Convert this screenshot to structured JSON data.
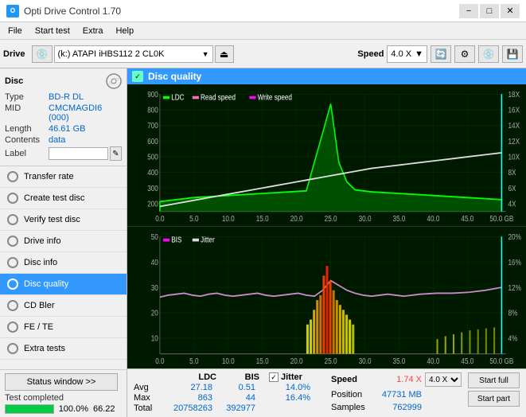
{
  "titlebar": {
    "title": "Opti Drive Control 1.70",
    "icon": "O",
    "min": "−",
    "max": "□",
    "close": "✕"
  },
  "menubar": {
    "items": [
      "File",
      "Start test",
      "Extra",
      "Help"
    ]
  },
  "toolbar": {
    "drive_label": "Drive",
    "drive_value": "(k:) ATAPI iHBS112  2 CL0K",
    "speed_label": "Speed",
    "speed_value": "4.0 X"
  },
  "sidebar": {
    "disc_title": "Disc",
    "disc_type_label": "Type",
    "disc_type_value": "BD-R DL",
    "disc_mid_label": "MID",
    "disc_mid_value": "CMCMAGDI6 (000)",
    "disc_length_label": "Length",
    "disc_length_value": "46.61 GB",
    "disc_contents_label": "Contents",
    "disc_contents_value": "data",
    "disc_label_label": "Label",
    "disc_label_value": "",
    "nav_items": [
      {
        "id": "transfer-rate",
        "label": "Transfer rate",
        "active": false
      },
      {
        "id": "create-test-disc",
        "label": "Create test disc",
        "active": false
      },
      {
        "id": "verify-test-disc",
        "label": "Verify test disc",
        "active": false
      },
      {
        "id": "drive-info",
        "label": "Drive info",
        "active": false
      },
      {
        "id": "disc-info",
        "label": "Disc info",
        "active": false
      },
      {
        "id": "disc-quality",
        "label": "Disc quality",
        "active": true
      },
      {
        "id": "cd-bler",
        "label": "CD Bler",
        "active": false
      },
      {
        "id": "fe-te",
        "label": "FE / TE",
        "active": false
      },
      {
        "id": "extra-tests",
        "label": "Extra tests",
        "active": false
      }
    ],
    "status_window_btn": "Status window >>",
    "status_text": "Test completed",
    "progress_pct": "100.0%",
    "progress_time": "66.22"
  },
  "chart": {
    "top_legend": {
      "ldc_label": "LDC",
      "read_label": "Read speed",
      "write_label": "Write speed"
    },
    "bottom_legend": {
      "bis_label": "BIS",
      "jitter_label": "Jitter"
    },
    "top_y_left_max": "900",
    "top_y_right_max": "18X",
    "top_x_labels": [
      "0.0",
      "5.0",
      "10.0",
      "15.0",
      "20.0",
      "25.0",
      "30.0",
      "35.0",
      "40.0",
      "45.0",
      "50.0 GB"
    ],
    "bottom_y_left_max": "50",
    "bottom_y_right_max": "20%",
    "bottom_x_labels": [
      "0.0",
      "5.0",
      "10.0",
      "15.0",
      "20.0",
      "25.0",
      "30.0",
      "35.0",
      "40.0",
      "45.0",
      "50.0 GB"
    ]
  },
  "stats": {
    "col_headers": [
      "",
      "LDC",
      "BIS",
      "",
      "Jitter",
      "Speed",
      "",
      ""
    ],
    "avg_label": "Avg",
    "avg_ldc": "27.18",
    "avg_bis": "0.51",
    "avg_jitter": "14.0%",
    "avg_speed": "1.74 X",
    "max_label": "Max",
    "max_ldc": "863",
    "max_bis": "44",
    "max_jitter": "16.4%",
    "max_position": "47731 MB",
    "total_label": "Total",
    "total_ldc": "20758263",
    "total_bis": "392977",
    "total_samples": "762999",
    "position_label": "Position",
    "samples_label": "Samples",
    "speed_select_value": "4.0 X",
    "start_full_label": "Start full",
    "start_part_label": "Start part",
    "jitter_checked": true,
    "jitter_label": "Jitter"
  }
}
